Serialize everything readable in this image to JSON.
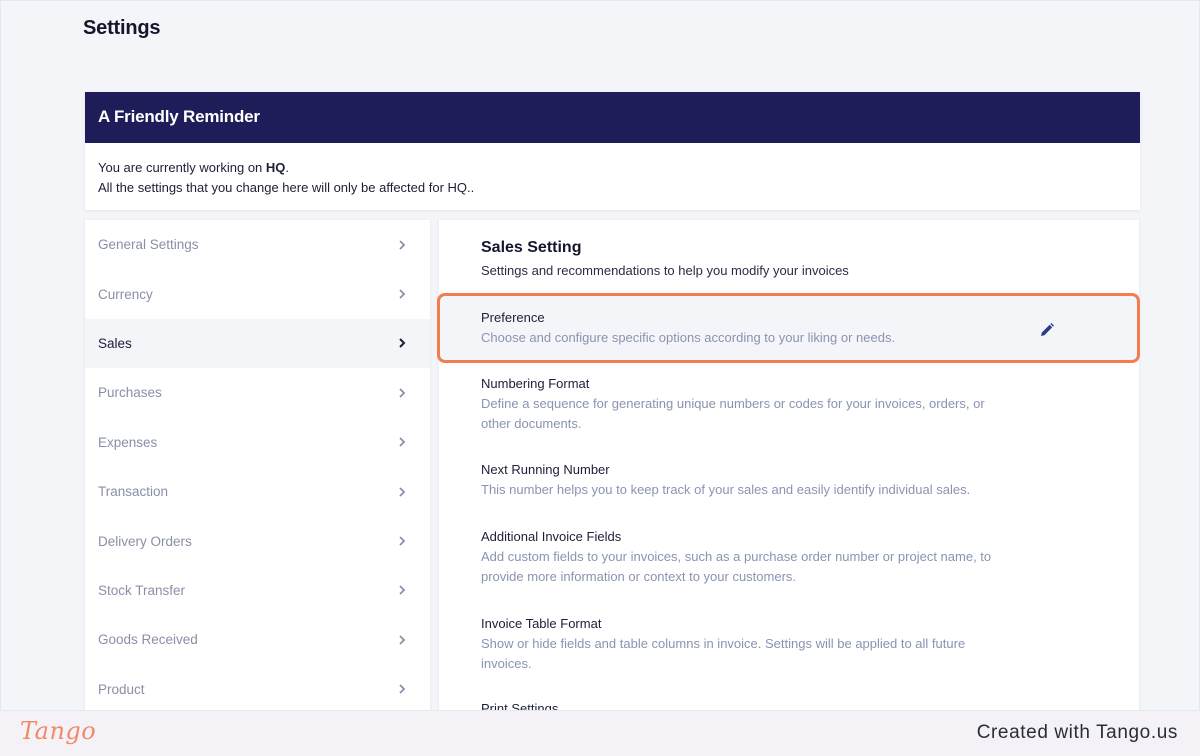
{
  "page": {
    "title": "Settings"
  },
  "reminder": {
    "title": "A Friendly Reminder",
    "line1_prefix": "You are currently working on ",
    "line1_bold": "HQ",
    "line1_suffix": ".",
    "line2": "All the settings that you change here will only be affected for HQ.."
  },
  "sidebar": {
    "items": [
      {
        "label": "General Settings",
        "active": false
      },
      {
        "label": "Currency",
        "active": false
      },
      {
        "label": "Sales",
        "active": true
      },
      {
        "label": "Purchases",
        "active": false
      },
      {
        "label": "Expenses",
        "active": false
      },
      {
        "label": "Transaction",
        "active": false
      },
      {
        "label": "Delivery Orders",
        "active": false
      },
      {
        "label": "Stock Transfer",
        "active": false
      },
      {
        "label": "Goods Received",
        "active": false
      },
      {
        "label": "Product",
        "active": false
      }
    ]
  },
  "main": {
    "title": "Sales Setting",
    "subtitle": "Settings and recommendations to help you modify your invoices",
    "settings": [
      {
        "title": "Preference",
        "desc": "Choose and configure specific options according to your liking or needs.",
        "icon": "pencil-icon"
      },
      {
        "title": "Numbering Format",
        "desc": "Define a sequence for generating unique numbers or codes for your invoices, orders, or other documents."
      },
      {
        "title": "Next Running Number",
        "desc": "This number helps you to keep track of your sales and easily identify individual sales."
      },
      {
        "title": "Additional Invoice Fields",
        "desc": "Add custom fields to your invoices, such as a purchase order number or project name, to provide more information or context to your customers."
      },
      {
        "title": "Invoice Table Format",
        "desc": "Show or hide fields and table columns in invoice. Settings will be applied to all future invoices."
      },
      {
        "title": "Print Settings",
        "desc": ""
      }
    ]
  },
  "footer": {
    "logo": "Tango",
    "credit": "Created with Tango.us"
  },
  "colors": {
    "header_bg": "#1f1d59",
    "highlight_border": "#f47c4d",
    "edit_icon": "#2e3a8c"
  }
}
